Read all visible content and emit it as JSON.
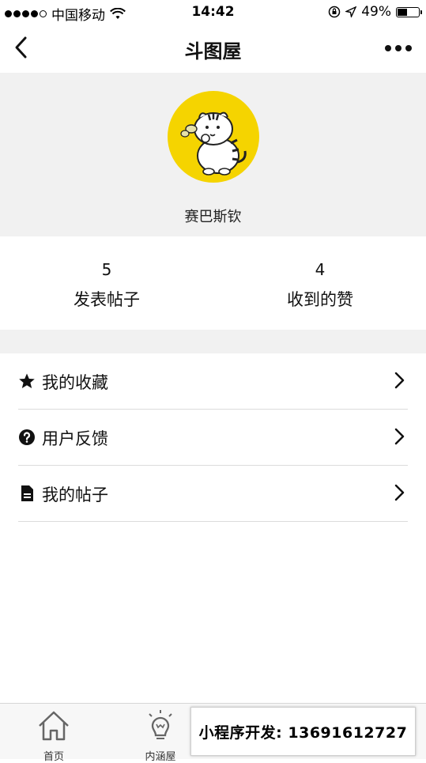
{
  "status_bar": {
    "carrier": "中国移动",
    "time": "14:42",
    "battery_text": "49%",
    "battery_level": 0.49,
    "signal_bars_filled": 4,
    "signal_bars_total": 5
  },
  "navbar": {
    "title": "斗图屋",
    "back_icon": "chevron-left-icon",
    "more_icon": "more-dots-icon"
  },
  "profile": {
    "username": "赛巴斯钦",
    "avatar_bg": "#f5d400"
  },
  "stats": [
    {
      "value": "5",
      "label": "发表帖子"
    },
    {
      "value": "4",
      "label": "收到的赞"
    }
  ],
  "menu": [
    {
      "label": "我的收藏",
      "icon": "star-icon"
    },
    {
      "label": "用户反馈",
      "icon": "question-circle-icon"
    },
    {
      "label": "我的帖子",
      "icon": "document-icon"
    }
  ],
  "tabbar": [
    {
      "label": "首页",
      "icon": "home-icon"
    },
    {
      "label": "内涵屋",
      "icon": "bulb-icon"
    },
    {
      "label": "",
      "icon": "tab-icon"
    },
    {
      "label": "",
      "icon": "tab-icon"
    }
  ],
  "promo": {
    "text": "小程序开发: 13691612727"
  }
}
